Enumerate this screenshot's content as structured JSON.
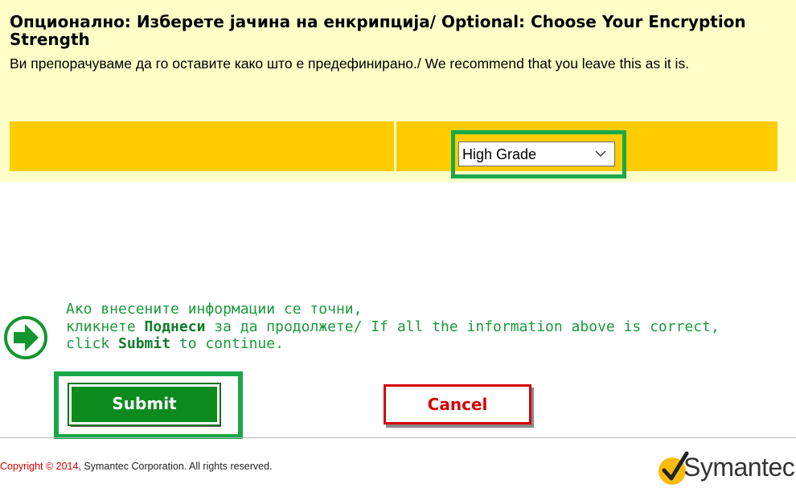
{
  "encryption": {
    "title": "Опционално: Изберете јачина на енкрипција/ Optional: Choose Your Encryption Strength",
    "description": "Ви препорачуваме да го оставите како што е предефинирано./ We recommend that you leave this as it is.",
    "select_value": "High Grade"
  },
  "instructions": {
    "line1": "Ако внесените информации се точни,",
    "line2_pre": "кликнете ",
    "line2_bold": "Поднеси",
    "line2_post": " за да продолжете/ If all the information above is correct,",
    "line3_pre": "click ",
    "line3_bold": "Submit",
    "line3_post": " to continue."
  },
  "buttons": {
    "submit": "Submit",
    "cancel": "Cancel"
  },
  "footer": {
    "copyright_link": "Copyright © 2014",
    "copyright_rest": ", Symantec Corporation. All rights reserved.",
    "logo_text": "Symantec"
  },
  "colors": {
    "highlight": "#18a84a",
    "panel_bg": "#ffffc8",
    "band": "#ffcc00",
    "submit_bg": "#0d8a1e",
    "cancel_border": "#d40000"
  }
}
